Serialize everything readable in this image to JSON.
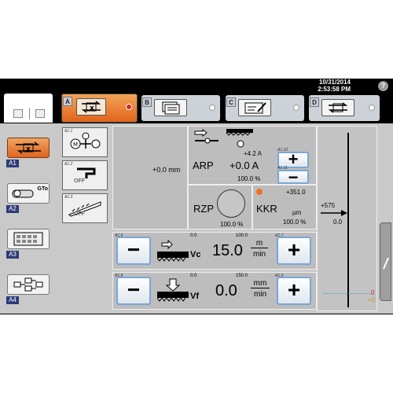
{
  "status": {
    "date": "10/31/2014",
    "time": "2:53:58 PM",
    "help_label": "?"
  },
  "tabs": [
    {
      "letter": "A",
      "active": true
    },
    {
      "letter": "B",
      "active": false
    },
    {
      "letter": "C",
      "active": false
    },
    {
      "letter": "D",
      "active": false
    }
  ],
  "sidebar": [
    {
      "tag": "A1",
      "active": true
    },
    {
      "tag": "A2",
      "label": "GTo"
    },
    {
      "tag": "A3"
    },
    {
      "tag": "A4"
    }
  ],
  "toggles": [
    {
      "tag": "A1.1"
    },
    {
      "tag": "A1.2",
      "label": "OFF"
    },
    {
      "tag": "A1.3",
      "label": "OFF"
    }
  ],
  "left_panel": {
    "value": "+0.0 mm"
  },
  "arp": {
    "label": "ARP",
    "small_value": "+4.2 A",
    "value": "+0.0 A",
    "percent": "100.0 %",
    "plus_tag": "A1.10",
    "minus_tag": "A1.11",
    "plus": "+",
    "minus": "−"
  },
  "rzp": {
    "label": "RZP",
    "percent": "100.0 %"
  },
  "kkr": {
    "label": "KKR",
    "small_value": "+351.0",
    "unit": "µm",
    "percent": "100.0 %",
    "indicator_color": "#f07020"
  },
  "vc": {
    "minus_tag": "A1.6",
    "plus_tag": "A1.7",
    "min_label": "0.0",
    "max_label": "100.0",
    "label": "Vc",
    "value": "15.0",
    "unit_top": "m",
    "unit_bottom": "min",
    "minus": "−",
    "plus": "+"
  },
  "vf": {
    "minus_tag": "A1.8",
    "plus_tag": "A1.9",
    "min_label": "0.0",
    "max_label": "150.0",
    "label": "Vf",
    "value": "0.0",
    "unit_top": "mm",
    "unit_bottom": "min",
    "minus": "−",
    "plus": "+"
  },
  "gauge": {
    "top_label": "+575",
    "sub_label": "0.0",
    "bottom_red": "0",
    "bottom_yellow": "+0"
  },
  "colors": {
    "accent": "#e8782a",
    "button_border": "#7aa6d6",
    "tag_blue": "#2e3a78"
  }
}
